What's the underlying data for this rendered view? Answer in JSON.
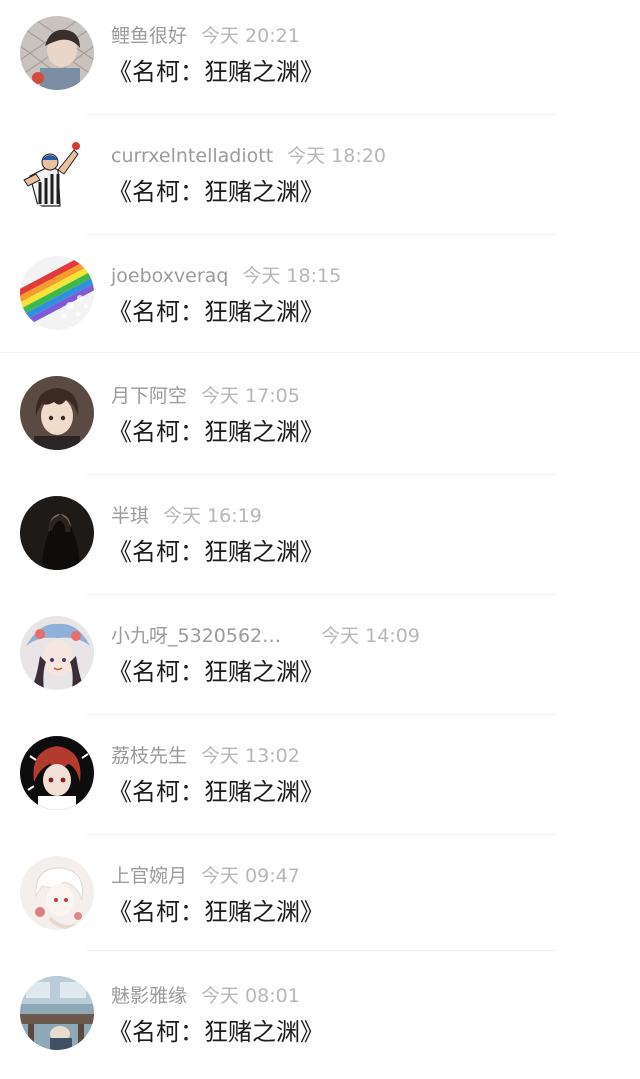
{
  "comments": [
    {
      "username": "鲤鱼很好",
      "time": "今天 20:21",
      "text": "《名柯：狂赌之渊》",
      "avatar_icon": "avatar-anime-boy-fence"
    },
    {
      "username": "currxelntelladiott",
      "time": "今天 18:20",
      "text": "《名柯：狂赌之渊》",
      "avatar_icon": "avatar-referee"
    },
    {
      "username": "joeboxveraq",
      "time": "今天 18:15",
      "text": "《名柯：狂赌之渊》",
      "avatar_icon": "avatar-rainbow-paint"
    },
    {
      "username": "月下阿空",
      "time": "今天 17:05",
      "text": "《名柯：狂赌之渊》",
      "avatar_icon": "avatar-anime-boy-brown-hair"
    },
    {
      "username": "半琪",
      "time": "今天 16:19",
      "text": "《名柯：狂赌之渊》",
      "avatar_icon": "avatar-dark-portrait"
    },
    {
      "username": "小九呀_5320562…",
      "time": "今天 14:09",
      "text": "《名柯：狂赌之渊》",
      "avatar_icon": "avatar-anime-girl-blue"
    },
    {
      "username": "荔枝先生",
      "time": "今天 13:02",
      "text": "《名柯：狂赌之渊》",
      "avatar_icon": "avatar-anime-red-hair"
    },
    {
      "username": "上官婉月",
      "time": "今天 09:47",
      "text": "《名柯：狂赌之渊》",
      "avatar_icon": "avatar-white-anime"
    },
    {
      "username": "魅影雅缘",
      "time": "今天 08:01",
      "text": "《名柯：狂赌之渊》",
      "avatar_icon": "avatar-classroom"
    }
  ]
}
